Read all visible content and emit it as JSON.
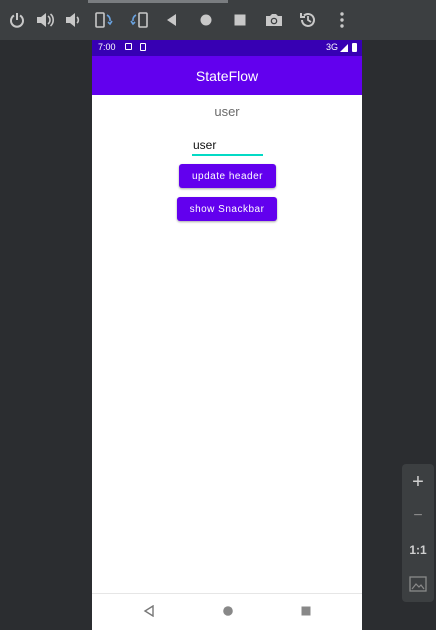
{
  "app": {
    "title": "StateFlow"
  },
  "status_bar": {
    "time": "7:00",
    "network": "3G"
  },
  "main": {
    "header_text": "user",
    "input_value": "user",
    "update_button": "update header",
    "snackbar_button": "show Snackbar"
  },
  "zoom_panel": {
    "zoom_in": "+",
    "zoom_out": "−",
    "actual_size": "1:1"
  },
  "colors": {
    "app_bar": "#6200ee",
    "status_bar": "#3700b3",
    "button": "#6200ee",
    "input_underline": "#03dac5"
  },
  "icons": {
    "toolbar": [
      "power-icon",
      "volume-up-icon",
      "volume-down-icon",
      "rotate-left-icon",
      "rotate-right-icon",
      "back-icon",
      "home-icon",
      "overview-icon",
      "camera-icon",
      "snapshot-icon",
      "more-icon"
    ],
    "navbar": [
      "nav-back-icon",
      "nav-home-icon",
      "nav-recents-icon"
    ]
  }
}
